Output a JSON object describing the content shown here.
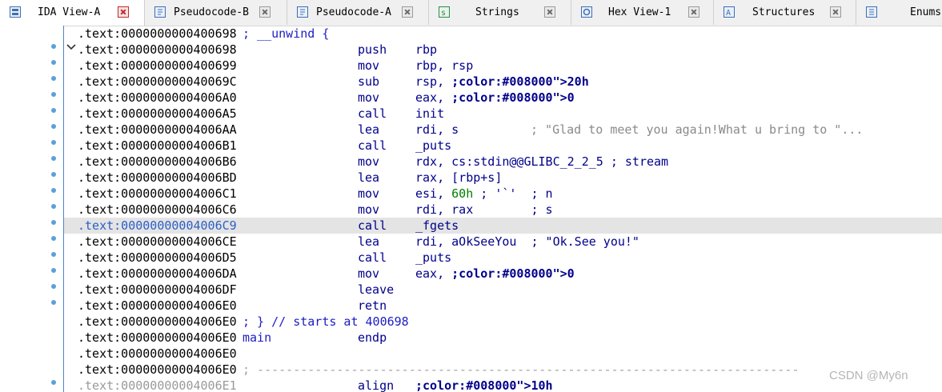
{
  "tabs": [
    {
      "label": "IDA View-A",
      "icon": "graph-view-icon",
      "active": true
    },
    {
      "label": "Pseudocode-B",
      "icon": "pseudocode-icon",
      "active": false
    },
    {
      "label": "Pseudocode-A",
      "icon": "pseudocode-icon",
      "active": false
    },
    {
      "label": "Strings",
      "icon": "strings-icon",
      "active": false
    },
    {
      "label": "Hex View-1",
      "icon": "hex-view-icon",
      "active": false
    },
    {
      "label": "Structures",
      "icon": "structures-icon",
      "active": false
    },
    {
      "label": "Enums",
      "icon": "enums-icon",
      "active": false
    }
  ],
  "listing": [
    {
      "addr": ".text:0000000000400698",
      "label": "",
      "mnemonic": "",
      "operands": "",
      "comment": "; __unwind {",
      "comment_color": "blue"
    },
    {
      "addr": ".text:0000000000400698",
      "label": "",
      "mnemonic": "push",
      "operands": "rbp",
      "comment": ""
    },
    {
      "addr": ".text:0000000000400699",
      "label": "",
      "mnemonic": "mov",
      "operands": "rbp, rsp",
      "comment": ""
    },
    {
      "addr": ".text:000000000040069C",
      "label": "",
      "mnemonic": "sub",
      "operands": "rsp, 20h",
      "comment": ""
    },
    {
      "addr": ".text:00000000004006A0",
      "label": "",
      "mnemonic": "mov",
      "operands": "eax, 0",
      "comment": ""
    },
    {
      "addr": ".text:00000000004006A5",
      "label": "",
      "mnemonic": "call",
      "operands": "init",
      "comment": ""
    },
    {
      "addr": ".text:00000000004006AA",
      "label": "",
      "mnemonic": "lea",
      "operands": "rdi, s",
      "comment": "; \"Glad to meet you again!What u bring to \"..."
    },
    {
      "addr": ".text:00000000004006B1",
      "label": "",
      "mnemonic": "call",
      "operands": "_puts",
      "comment": ""
    },
    {
      "addr": ".text:00000000004006B6",
      "label": "",
      "mnemonic": "mov",
      "operands": "rdx, cs:stdin@@GLIBC_2_2_5 ; stream",
      "comment": ""
    },
    {
      "addr": ".text:00000000004006BD",
      "label": "",
      "mnemonic": "lea",
      "operands": "rax, [rbp+s]",
      "comment": ""
    },
    {
      "addr": ".text:00000000004006C1",
      "label": "",
      "mnemonic": "mov",
      "operands": "esi, 60h ; '`'  ; n",
      "comment": ""
    },
    {
      "addr": ".text:00000000004006C6",
      "label": "",
      "mnemonic": "mov",
      "operands": "rdi, rax        ; s",
      "comment": ""
    },
    {
      "addr": ".text:00000000004006C9",
      "label": "",
      "mnemonic": "call",
      "operands": "_fgets",
      "comment": "",
      "highlight": true
    },
    {
      "addr": ".text:00000000004006CE",
      "label": "",
      "mnemonic": "lea",
      "operands": "rdi, aOkSeeYou  ; \"Ok.See you!\"",
      "comment": ""
    },
    {
      "addr": ".text:00000000004006D5",
      "label": "",
      "mnemonic": "call",
      "operands": "_puts",
      "comment": ""
    },
    {
      "addr": ".text:00000000004006DA",
      "label": "",
      "mnemonic": "mov",
      "operands": "eax, 0",
      "comment": ""
    },
    {
      "addr": ".text:00000000004006DF",
      "label": "",
      "mnemonic": "leave",
      "operands": "",
      "comment": ""
    },
    {
      "addr": ".text:00000000004006E0",
      "label": "",
      "mnemonic": "retn",
      "operands": "",
      "comment": ""
    },
    {
      "addr": ".text:00000000004006E0",
      "label": "",
      "mnemonic": "",
      "operands": "",
      "comment": "; } // starts at 400698",
      "comment_color": "blue"
    },
    {
      "addr": ".text:00000000004006E0",
      "label": "main",
      "mnemonic": "endp",
      "operands": "",
      "comment": ""
    },
    {
      "addr": ".text:00000000004006E0",
      "label": "",
      "mnemonic": "",
      "operands": "",
      "comment": ""
    },
    {
      "addr": ".text:00000000004006E0",
      "label": "",
      "mnemonic": "",
      "operands": "",
      "comment": "; ---------------------------------------------------------------------------",
      "comment_color": "gray"
    },
    {
      "addr": ".text:00000000004006E1",
      "label": "",
      "mnemonic": "align",
      "operands": "10h",
      "comment": "",
      "addr_color": "gray"
    }
  ],
  "watermark": "CSDN @My6n",
  "colors": {
    "gutter_line": "#4f86c6",
    "highlight": "#e4e4e4",
    "addr_highlight": "#2b5fc7",
    "mnemonic": "#00008b",
    "label": "#1c1cc4",
    "number": "#008000"
  }
}
